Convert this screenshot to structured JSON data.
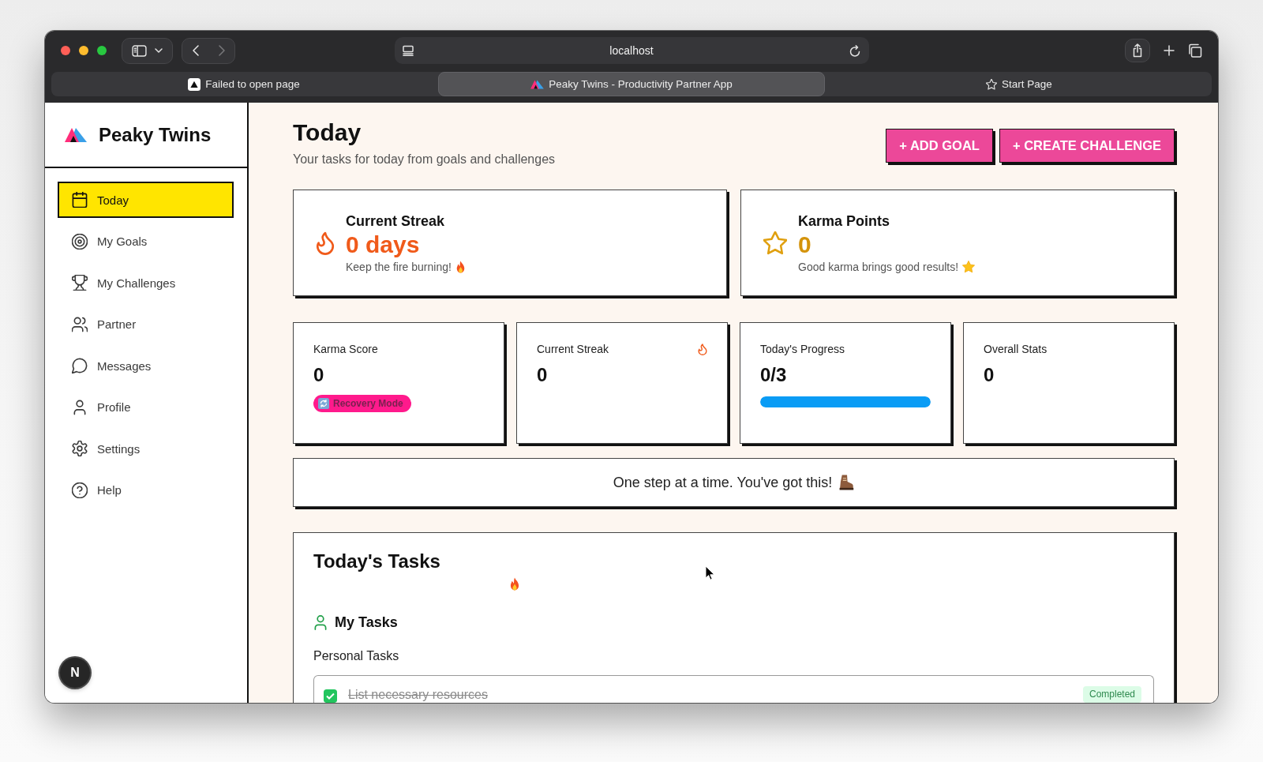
{
  "browser": {
    "address": "localhost",
    "back_disabled": false,
    "forward_disabled": true,
    "tabs": [
      {
        "title": "Failed to open page",
        "selected": false
      },
      {
        "title": "Peaky Twins - Productivity Partner App",
        "selected": true
      },
      {
        "title": "Start Page",
        "selected": false
      }
    ]
  },
  "sidebar": {
    "brand": "Peaky Twins",
    "items": [
      {
        "label": "Today",
        "selected": true
      },
      {
        "label": "My Goals",
        "selected": false
      },
      {
        "label": "My Challenges",
        "selected": false
      },
      {
        "label": "Partner",
        "selected": false
      },
      {
        "label": "Messages",
        "selected": false
      },
      {
        "label": "Profile",
        "selected": false
      },
      {
        "label": "Settings",
        "selected": false
      },
      {
        "label": "Help",
        "selected": false
      }
    ],
    "corner_button": "N"
  },
  "header": {
    "title": "Today",
    "subtitle": "Your tasks for today from goals and challenges",
    "buttons": [
      "+ ADD GOAL",
      "+ CREATE CHALLENGE"
    ]
  },
  "highlights": [
    {
      "kind": "streak",
      "title": "Current Streak",
      "value": "0 days",
      "note": "Keep the fire burning!"
    },
    {
      "kind": "karma",
      "title": "Karma Points",
      "value": "0",
      "note": "Good karma brings good results!"
    }
  ],
  "stats": [
    {
      "kind": "badge",
      "label": "Karma Score",
      "value": "0",
      "badge": "Recovery Mode"
    },
    {
      "kind": "streak",
      "label": "Current Streak",
      "value": "0"
    },
    {
      "kind": "progress",
      "label": "Today's Progress",
      "value": "0/3",
      "level": 1
    },
    {
      "kind": "plain",
      "label": "Overall Stats",
      "value": "0"
    }
  ],
  "motivation": "One step at a time. You've got this!",
  "tasks": {
    "title": "Today's Tasks",
    "section": "My Tasks",
    "subsection": "Personal Tasks",
    "items": [
      {
        "title": "List necessary resources",
        "done": true,
        "status": "Completed"
      }
    ]
  }
}
